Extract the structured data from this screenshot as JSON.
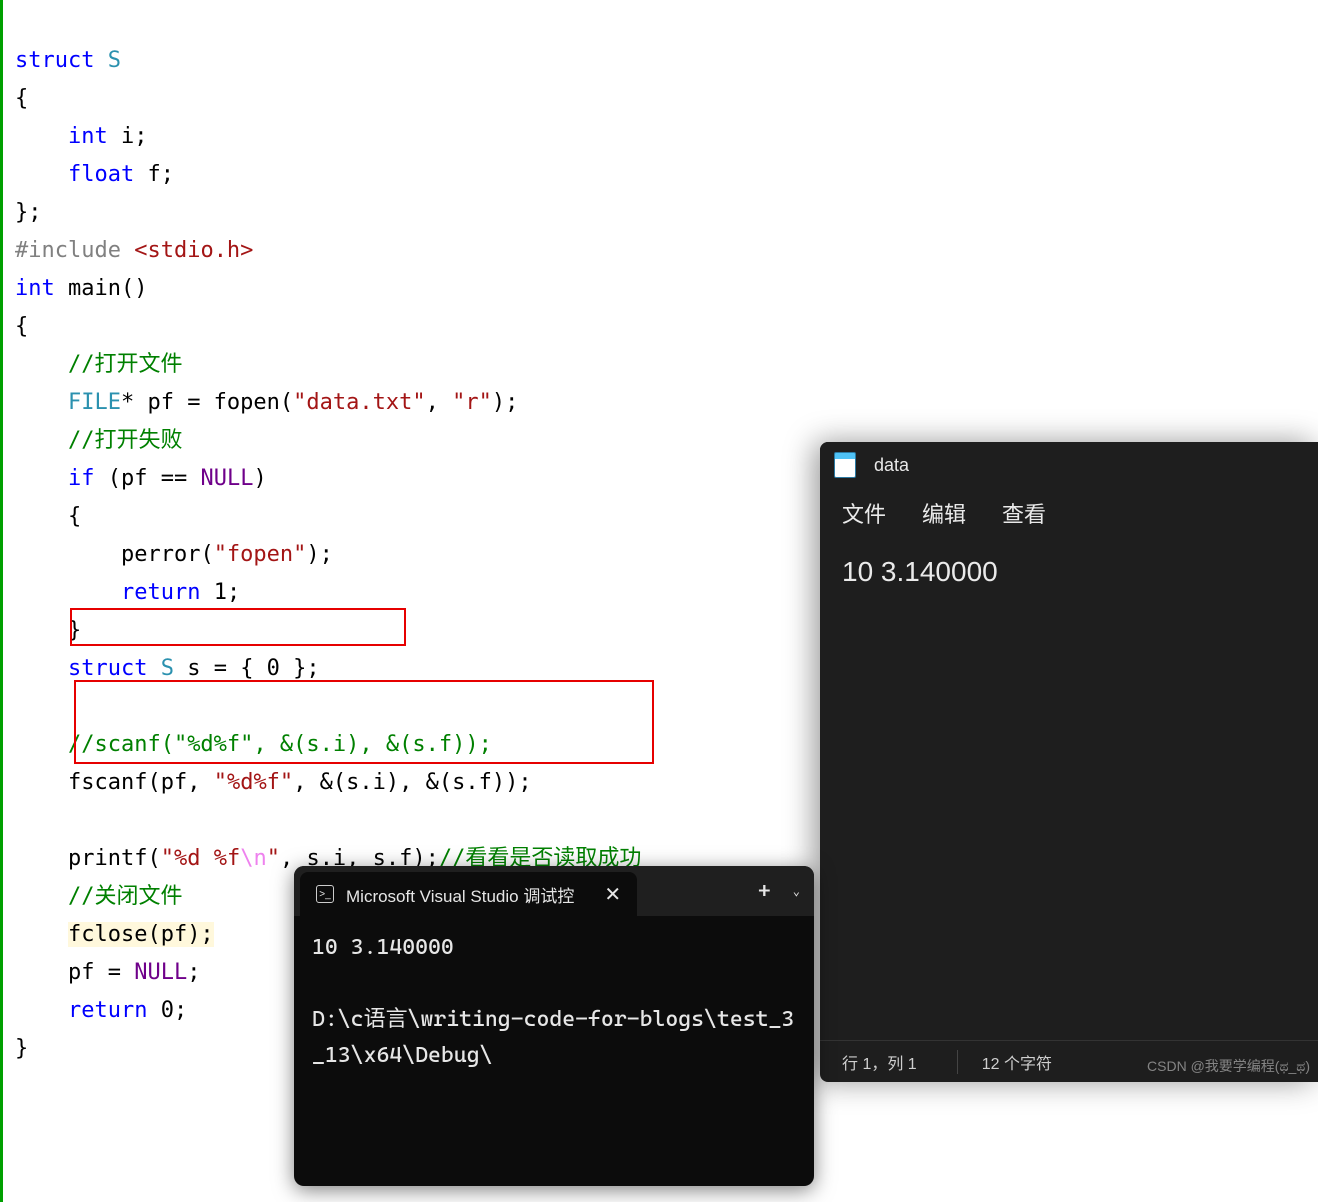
{
  "code": {
    "struct_kw": "struct",
    "struct_name": "S",
    "brace_open": "{",
    "int_kw": "int",
    "field_i": " i;",
    "float_kw": "float",
    "field_f": " f;",
    "brace_close": "};",
    "include_kw": "#include",
    "include_file": "<stdio.h>",
    "int_kw2": "int",
    "main": "main",
    "main_paren": "()",
    "brace_open2": "{",
    "comment_open": "//打开文件",
    "file_type": "FILE",
    "pf_decl": "* pf = fopen(",
    "str_data": "\"data.txt\"",
    "comma": ", ",
    "str_r": "\"r\"",
    "close_call": ");",
    "comment_fail": "//打开失败",
    "if_kw": "if",
    "if_cond": " (pf == ",
    "null_kw": "NULL",
    "if_close": ")",
    "brace_open3": "{",
    "perror_call": "perror(",
    "str_fopen": "\"fopen\"",
    "perror_close": ");",
    "return_kw": "return",
    "return_1": " 1;",
    "brace_close2": "}",
    "struct_decl_kw": "struct",
    "struct_decl_name": " S",
    "struct_decl_rest": " s = { 0 };",
    "comment_scanf": "//scanf(\"%d%f\", &(s.i), &(s.f));",
    "fscanf_name": "fscanf",
    "fscanf_open": "(pf, ",
    "str_fmt": "\"%d%f\"",
    "fscanf_args": ", &(s.i), &(s.f));",
    "printf_name": "printf",
    "printf_open": "(",
    "str_pfmt": "\"%d %f",
    "esc_n": "\\n",
    "str_pfmt_close": "\"",
    "printf_args": ", s.i, s.f);",
    "comment_check": "//看看是否读取成功",
    "comment_close_file": "//关闭文件",
    "fclose_call": "fclose(pf);",
    "pf_null": "pf = ",
    "null_kw2": "NULL",
    "semi": ";",
    "return_kw2": "return",
    "return_0": " 0;",
    "brace_close3": "}"
  },
  "notepad": {
    "title": "data",
    "menu": {
      "file": "文件",
      "edit": "编辑",
      "view": "查看"
    },
    "content": "10 3.140000",
    "status": {
      "pos": "行 1，列 1",
      "chars": "12 个字符"
    }
  },
  "terminal": {
    "tab_title": "Microsoft Visual Studio 调试控",
    "add": "+",
    "drop": "⌄",
    "close": "✕",
    "output_line1": "10 3.140000",
    "output_line2": "D:\\c语言\\writing-code-for-blogs\\test_3_13\\x64\\Debug\\"
  },
  "watermark": "CSDN @我要学编程(ಥ_ಥ)"
}
